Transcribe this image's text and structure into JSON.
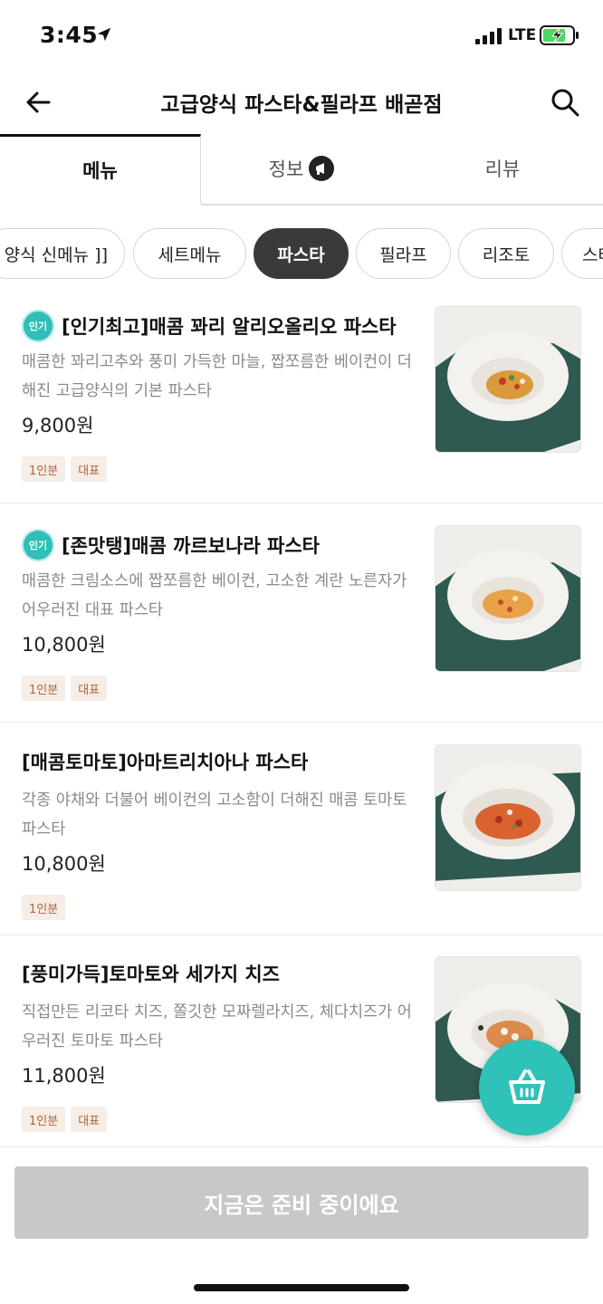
{
  "status_bar": {
    "time": "3:45",
    "network": "LTE"
  },
  "header": {
    "title": "고급양식 파스타&필라프 배곧점"
  },
  "tabs": [
    {
      "label": "메뉴"
    },
    {
      "label": "정보"
    },
    {
      "label": "리뷰"
    }
  ],
  "categories": [
    {
      "label": "양식 신메뉴 ]]"
    },
    {
      "label": "세트메뉴"
    },
    {
      "label": "파스타"
    },
    {
      "label": "필라프"
    },
    {
      "label": "리조토"
    },
    {
      "label": "스테"
    }
  ],
  "menu": [
    {
      "badge": "인기",
      "name": "[인기최고]매콤 꽈리 알리오올리오 파스타",
      "desc": "매콤한 꽈리고추와 풍미 가득한 마늘, 짭쪼름한 베이컨이 더해진 고급양식의 기본 파스타",
      "price": "9,800원",
      "tags": [
        "1인분",
        "대표"
      ]
    },
    {
      "badge": "인기",
      "name": "[존맛탱]매콤 까르보나라 파스타",
      "desc": "매콤한 크림소스에 짭쪼름한 베이컨, 고소한 계란 노른자가 어우러진 대표 파스타",
      "price": "10,800원",
      "tags": [
        "1인분",
        "대표"
      ]
    },
    {
      "badge": "",
      "name": "[매콤토마토]아마트리치아나 파스타",
      "desc": "각종 야채와 더불어 베이컨의 고소함이 더해진 매콤 토마토 파스타",
      "price": "10,800원",
      "tags": [
        "1인분"
      ]
    },
    {
      "badge": "",
      "name": "[풍미가득]토마토와 세가지 치즈",
      "desc": "직접만든 리코타 치즈, 쫄깃한 모짜렐라치즈, 체다치즈가 어우러진 토마토 파스타",
      "price": "11,800원",
      "tags": [
        "1인분",
        "대표"
      ]
    }
  ],
  "bottom_button": {
    "label": "지금은 준비 중이에요"
  },
  "colors": {
    "accent": "#2fc2b8",
    "chip_active": "#3a3a3a",
    "tag_bg": "#f5ede6",
    "tag_text": "#b0643b",
    "disabled_button": "#c8c8c8"
  }
}
